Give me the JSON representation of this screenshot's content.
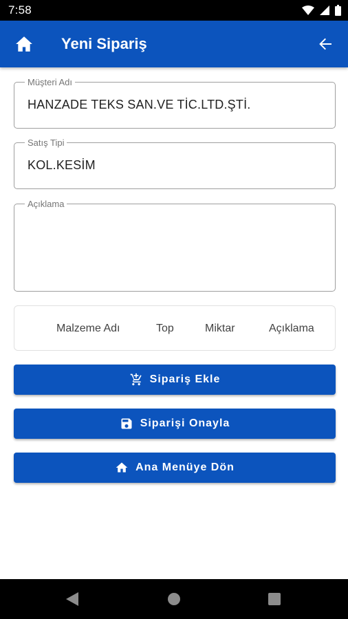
{
  "status_bar": {
    "time": "7:58"
  },
  "app_bar": {
    "title": "Yeni Sipariş",
    "home_icon": "home-icon",
    "back_icon": "arrow-back-icon"
  },
  "form": {
    "customer": {
      "label": "Müşteri Adı",
      "value": "HANZADE TEKS SAN.VE TİC.LTD.ŞTİ."
    },
    "sale_type": {
      "label": "Satış Tipi",
      "value": "KOL.KESİM"
    },
    "note": {
      "label": "Açıklama",
      "value": ""
    }
  },
  "table": {
    "columns": [
      "Malzeme Adı",
      "Top",
      "Miktar",
      "Açıklama"
    ]
  },
  "buttons": {
    "add_order": {
      "label": "Sipariş Ekle",
      "icon": "add-cart-icon"
    },
    "confirm_order": {
      "label": "Siparişi Onayla",
      "icon": "save-icon"
    },
    "main_menu": {
      "label": "Ana Menüye Dön",
      "icon": "home-icon"
    }
  },
  "colors": {
    "primary": "#0c54bd",
    "status_bar": "#000000",
    "nav_bar": "#000000"
  }
}
